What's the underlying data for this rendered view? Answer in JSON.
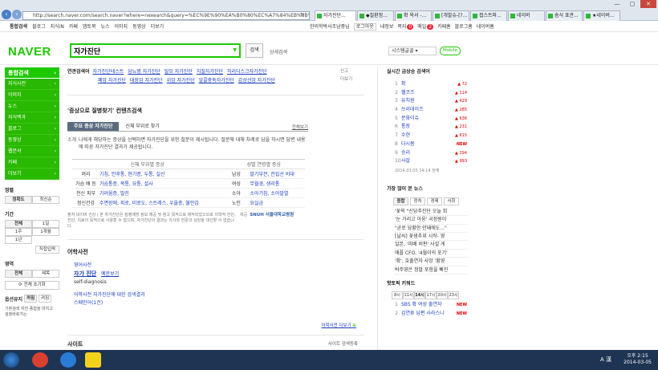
{
  "browser": {
    "url": "http://search.naver.com/search.naver?where=nexearch&query=%EC%9E%90%EA%B0%80%EC%A7%84%EB%8B%A8",
    "tabs": [
      {
        "label": "자가진단...",
        "active": true
      },
      {
        "label": "◆질환정..."
      },
      {
        "label": "확 옥서 -..."
      },
      {
        "label": "[개발슈-[?..."
      },
      {
        "label": "접스트파..."
      },
      {
        "label": "네이버"
      },
      {
        "label": "솜식 표관..."
      },
      {
        "label": "★네이버..."
      }
    ]
  },
  "topnav": {
    "left": [
      "통합검색",
      "블로그",
      "지식iN",
      "카페",
      "앱토북",
      "뉴스",
      "이미지",
      "동영상",
      "더보기"
    ],
    "right": [
      "한의학박사조남중님",
      "로그아웃",
      "내정보",
      "쪽지",
      "메일",
      "카페홈",
      "블로그홈",
      "네이버홈"
    ],
    "note_count": "0",
    "mail_count": "2"
  },
  "header": {
    "logo": "NAVER",
    "query": "자가진단",
    "search_button": "검색",
    "search_option": "상세검색",
    "right_links": [
      "시스템글꼴",
      "Mobile"
    ]
  },
  "sidebar": {
    "head": "통합검색",
    "items": [
      "지식사전",
      "이미지",
      "뉴스",
      "지식백과",
      "블로그",
      "동영상",
      "웹문서",
      "카페",
      "더보기"
    ],
    "sort_label": "정렬",
    "sort_options": [
      "정확도",
      "최신순"
    ],
    "period_label": "기간",
    "period_options": [
      "전체",
      "1일",
      "1주",
      "1개월",
      "1년"
    ],
    "period_apply": "직접입력",
    "area_label": "영역",
    "area_options": [
      "전체",
      "제목"
    ],
    "reset": "전체 초기화",
    "option_label": "옵션유지",
    "option_values": [
      "꺼짐",
      "켜짐"
    ],
    "footer_text": "기본검색 자진 종합을 마치고 설정바로가는"
  },
  "related": {
    "label": "연관검색어",
    "row1": [
      "자가진단테스트",
      "당뇨병 자가진단",
      "탈모 자가진단",
      "치질자가진단",
      "허리디스크자가진단"
    ],
    "row2": [
      "폐암 자가진단",
      "대장암 자가진단",
      "위암 자가진단",
      "알콜중독자가진단",
      "갑상선암 자가진단"
    ],
    "side": [
      "신고",
      "더보기"
    ]
  },
  "symptom": {
    "title": "'증상으로 질병찾기' 컨텐츠검색",
    "tabs": [
      "주요 증상 자가진단",
      "신체 부위로 찾기"
    ],
    "all_link": "전체보기",
    "desc": "나에게 해당하는 증상을 선택하면 자가진단을 위한 질문이 제시됩니다. 질문에 대해 차례로 답을 하시면 답변 내용에 따른 자가진단 결과가 제공됩니다.",
    "desc_label": "소개",
    "col_left": "신체 부위별 증상",
    "col_right": "성별 연령별 증상",
    "rows": [
      {
        "k": "머리",
        "v": "기침, 인후통, 현기증, 두통, 실신",
        "k2": "남성",
        "v2": "발기부전, 전립선 비대"
      },
      {
        "k": "가슴 배 등",
        "v": "가슴통증, 복통, 요통, 설사",
        "k2": "여성",
        "v2": "무월경, 생리통"
      },
      {
        "k": "전신 피부",
        "v": "가려움증, 발진",
        "k2": "소아",
        "v2": "소아기침, 소아발열"
      },
      {
        "k": "정신건강",
        "v": "수면장애, 피로, 미로도, 스트레스, 우울증, 불안감",
        "k2": "노인",
        "v2": "요실금"
      }
    ],
    "source_text": "출처 네이버 건강 | 본 자가진단은 질병예방 정보 제공 및 참고 목적으로 제작되었으므로 의학적 진단, 진단, 치료의 목적으로 사용할 수 없으며, 자가진단의 결과는 의사와 전문의 상담을 대신할 수 없습니다.",
    "source_logo": "SNUH 서울대학교병원",
    "source_tag": "제공"
  },
  "dictionary": {
    "title": "어학사전",
    "subtitle": "영어사전",
    "word": "자가 진단",
    "example_link": "예문보기",
    "meaning": "self-diagnosis",
    "kr_dict": "어학사전 자가진단에 대한 검색결과",
    "kr_link": "스페인어(1건)",
    "more": "어학사전 더보기"
  },
  "site_section": {
    "title": "사이트",
    "right": "사이트 검색등록"
  },
  "realtime": {
    "title": "실시간 급상승 검색어",
    "items": [
      {
        "n": "1",
        "t": "확",
        "d": "72"
      },
      {
        "n": "2",
        "t": "헬코즈",
        "d": "114"
      },
      {
        "n": "3",
        "t": "유치원",
        "d": "429"
      },
      {
        "n": "4",
        "t": "쓰리데이즈",
        "d": "285"
      },
      {
        "n": "5",
        "t": "문화이슈",
        "d": "636"
      },
      {
        "n": "6",
        "t": "통장",
        "d": "231"
      },
      {
        "n": "7",
        "t": "수현",
        "d": "615"
      },
      {
        "n": "8",
        "t": "다시봄",
        "d": "NEW"
      },
      {
        "n": "9",
        "t": "승리",
        "d": "294"
      },
      {
        "n": "10",
        "t": "사갈",
        "d": "993"
      }
    ],
    "time": "2014.03.05 14:14 현재"
  },
  "news": {
    "title": "가장 많이 본 뉴스",
    "tabs": [
      "종합",
      "정치",
      "경제",
      "사회"
    ],
    "items": [
      "'꽃옥 \"신당추진단 오늘 회",
      "'눈 가리고 아웅' 국정원이",
      "\"곧로 당황한 안돼에도...\"",
      "[날씨] 꽃샘추위 시작- 영",
      "일본, '미배 비판' 사설 게",
      "애플 CFO, '4월이의 포기'",
      "'확', 호출연자 사망 '황영",
      "박주영은 정말 포함을 빠진"
    ]
  },
  "hot": {
    "title": "핫토픽 키워드",
    "tabs": [
      "8시",
      "11시",
      "14시",
      "17시",
      "20시",
      "23시"
    ],
    "items": [
      {
        "n": "1",
        "t": "SBS 확 여성 출연자",
        "d": "NEW"
      },
      {
        "n": "2",
        "t": "김연휴 남편 사라스니",
        "d": "NEW"
      }
    ]
  },
  "taskbar": {
    "time": "오후 2:15",
    "date": "2014-03-05",
    "ime": "A 漢"
  }
}
